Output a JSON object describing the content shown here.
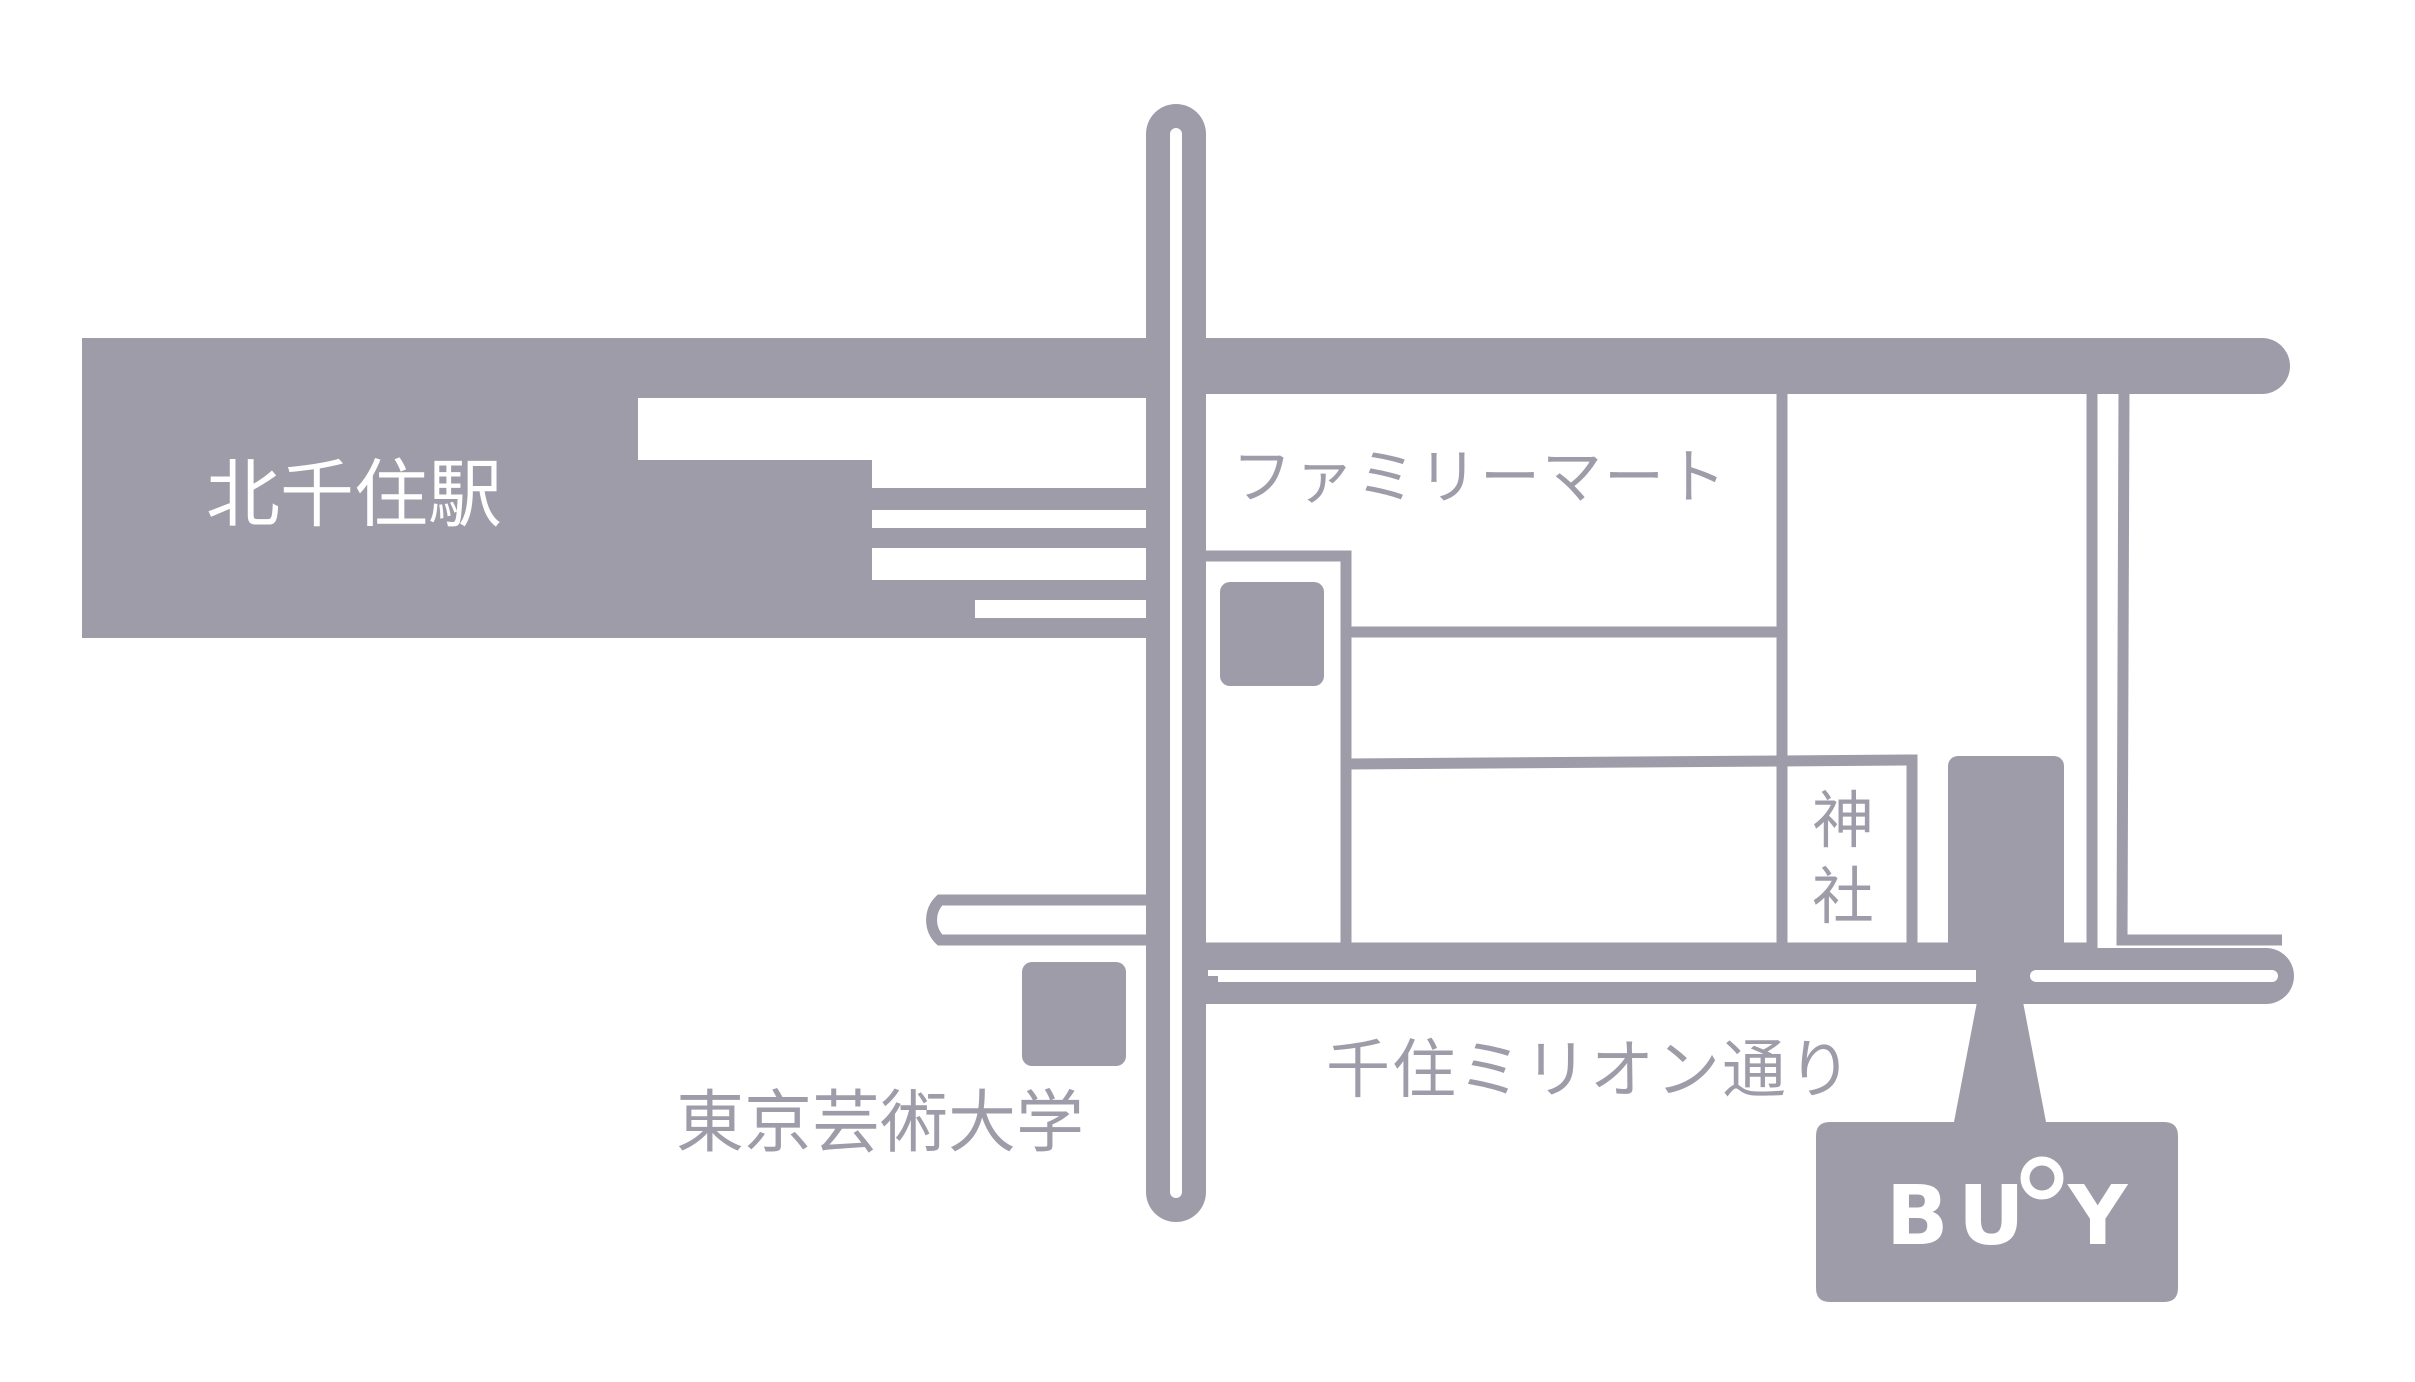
{
  "colors": {
    "road": "#9e9ca8",
    "background": "#ffffff",
    "label_on_dark": "#ffffff",
    "label_on_light": "#9e9ca8"
  },
  "stations": {
    "kitasenju": "北千住駅"
  },
  "landmarks": {
    "familymart": "ファミリーマート",
    "shrine_line1": "神",
    "shrine_line2": "社",
    "university": "東京芸術大学"
  },
  "streets": {
    "senju_million": "千住ミリオン通り"
  },
  "destination": {
    "letter_b": "B",
    "letter_u": "U",
    "letter_y": "Y",
    "icons": [
      "location-pin-icon",
      "buoy-ring-icon"
    ]
  }
}
